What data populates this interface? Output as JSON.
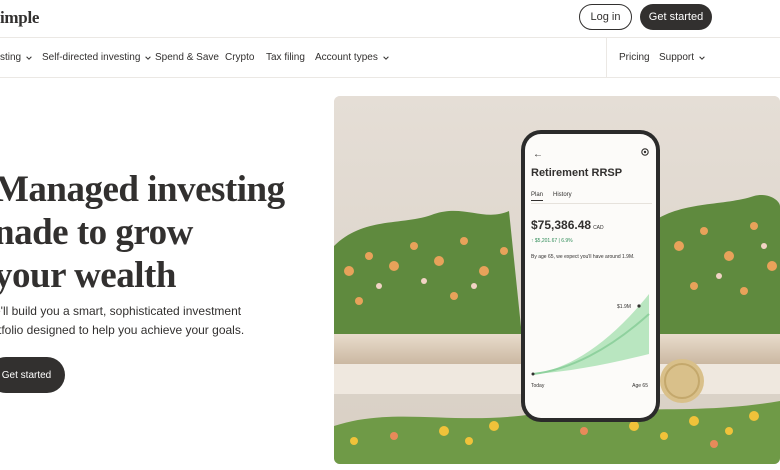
{
  "header": {
    "logo": "imple",
    "login_label": "Log in",
    "get_started_label": "Get started"
  },
  "nav": {
    "items": [
      {
        "label": "sting",
        "has_dropdown": true
      },
      {
        "label": "Self-directed investing",
        "has_dropdown": true
      },
      {
        "label": "Spend & Save",
        "has_dropdown": false
      },
      {
        "label": "Crypto",
        "has_dropdown": false
      },
      {
        "label": "Tax filing",
        "has_dropdown": false
      },
      {
        "label": "Account types",
        "has_dropdown": true
      }
    ],
    "right_items": [
      {
        "label": "Pricing",
        "has_dropdown": false
      },
      {
        "label": "Support",
        "has_dropdown": true
      }
    ]
  },
  "hero": {
    "title_lines": [
      "Managed investing",
      "nade to grow",
      "your wealth"
    ],
    "subtitle_lines": [
      "e'll build you a smart, sophisticated investment",
      "rtfolio designed to help you achieve your goals."
    ],
    "cta_label": "Get started"
  },
  "phone_screen": {
    "back_icon": "arrow-left-icon",
    "settings_icon": "gear-icon",
    "title": "Retirement RRSP",
    "tabs": [
      "Plan",
      "History"
    ],
    "active_tab": "Plan",
    "balance": "$75,386.48",
    "currency": "CAD",
    "gain": "↑ $5,201.67 | 6.9%",
    "projection_note": "By age 65, we expect you'll have around 1.9M.",
    "projection_label": "$1.9M",
    "axis_start": "Today",
    "axis_end": "Age 65"
  },
  "colors": {
    "primary_dark": "#32302f",
    "chart_green": "#8fd19e",
    "gain_green": "#2e8b57",
    "border": "#ebe8e4"
  }
}
